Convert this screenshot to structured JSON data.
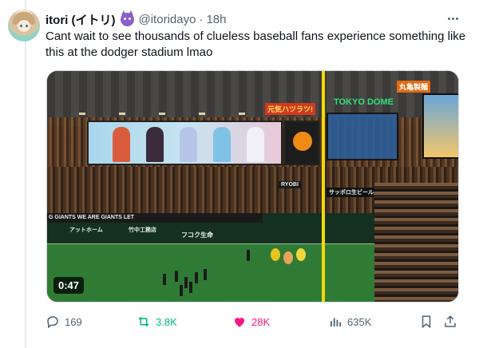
{
  "tweet": {
    "display_name": "itori (イトリ)",
    "badge_icon": "devil-emoji-icon",
    "handle": "@itoridayo",
    "separator": "·",
    "time": "18h",
    "text": "Cant wait to see thousands of clueless baseball fans experience something like this at the dodger stadium lmao"
  },
  "media": {
    "duration": "0:47",
    "signs": {
      "tokyo_dome": "TOKYO DOME",
      "red": "元気ハツラツ!",
      "orange": "丸亀製麺",
      "giants": "G GIANTS   WE ARE GIANTS   LET",
      "fukoku": "フコク生命",
      "ryobi": "RYOBI",
      "sapporo": "サッポロ生ビール黒ラベル",
      "takenaka": "竹中工務店",
      "athome": "アットホーム"
    }
  },
  "actions": {
    "replies": "169",
    "retweets": "3.8K",
    "likes": "28K",
    "views": "635K"
  },
  "colors": {
    "text": "#0f1419",
    "secondary": "#536471",
    "retweet": "#00ba7c",
    "like": "#f91880",
    "border": "#cfd9de"
  }
}
